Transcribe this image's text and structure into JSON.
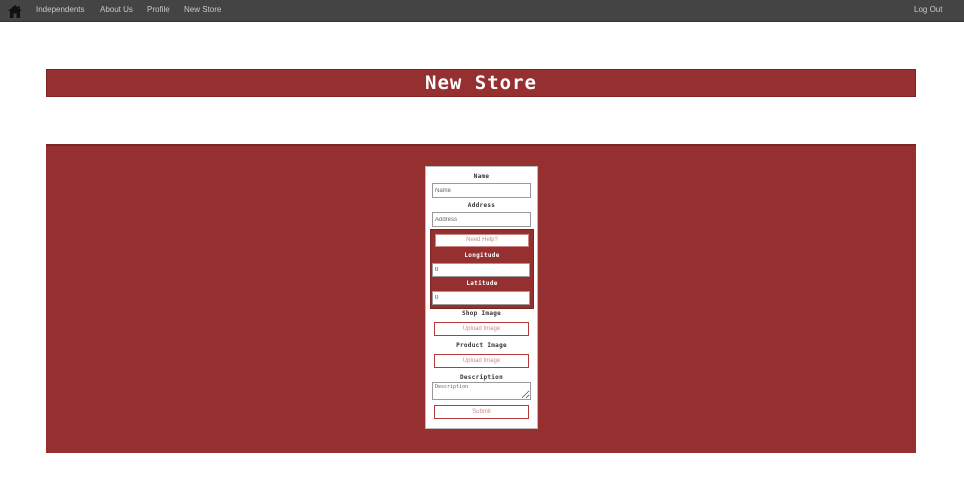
{
  "nav": {
    "home_icon": "home-icon",
    "links": [
      "Independents",
      "About Us",
      "Profile",
      "New Store"
    ],
    "logout": "Log Out"
  },
  "page": {
    "title": "New Store"
  },
  "form": {
    "name_label": "Name",
    "name_placeholder": "Name",
    "address_label": "Address",
    "address_placeholder": "Address",
    "help_button": "Need Help?",
    "longitude_label": "Longitude",
    "longitude_value": "0",
    "latitude_label": "Latitude",
    "latitude_value": "0",
    "shop_image_label": "Shop Image",
    "shop_upload_button": "Upload Image",
    "product_image_label": "Product Image",
    "product_upload_button": "Upload Image",
    "description_label": "Description",
    "description_placeholder": "Description",
    "submit_button": "Submit"
  },
  "colors": {
    "navbar": "#444444",
    "brand_red": "#963030",
    "white": "#ffffff"
  }
}
